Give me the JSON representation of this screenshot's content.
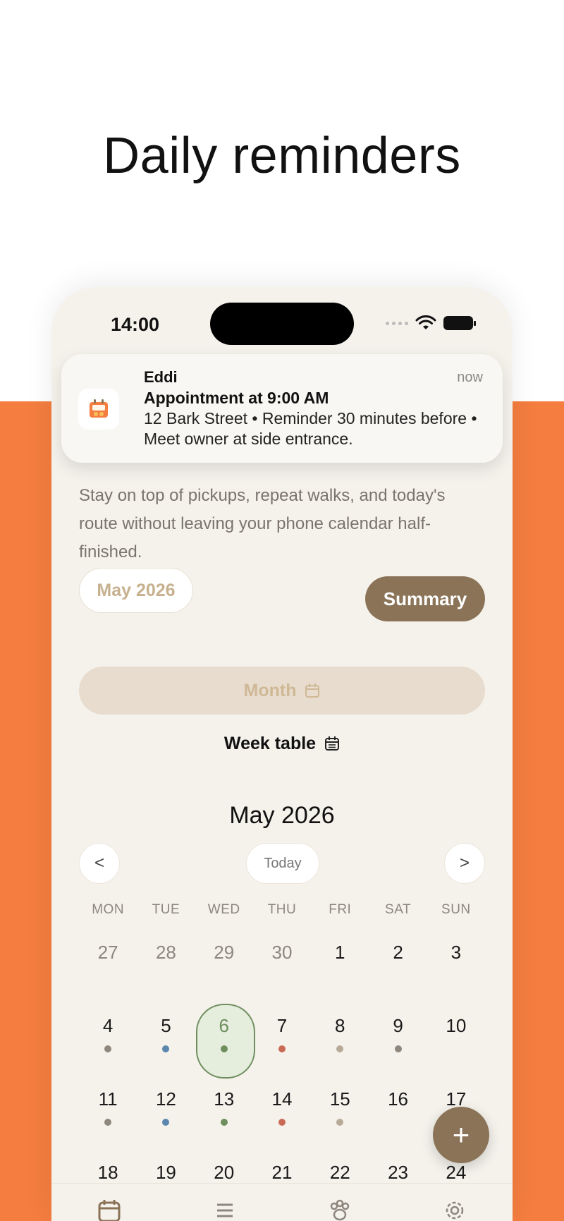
{
  "headline": "Daily reminders",
  "colors": {
    "accent": "#f47d3f",
    "brand": "#8a7357",
    "selected": "#6e8e5e"
  },
  "status_bar": {
    "time": "14:00"
  },
  "notification": {
    "app": "Eddi",
    "time": "now",
    "title": "Appointment at 9:00 AM",
    "body": "12 Bark Street • Reminder 30 minutes before • Meet owner at side entrance."
  },
  "intro": "Stay on top of pickups, repeat walks, and today's route without leaving your phone calendar half-finished.",
  "month_pill": "May 2026",
  "summary_label": "Summary",
  "view_toggle": {
    "month": "Month",
    "week": "Week table"
  },
  "calendar": {
    "title": "May 2026",
    "prev": "<",
    "next": ">",
    "today": "Today",
    "weekdays": [
      "MON",
      "TUE",
      "WED",
      "THU",
      "FRI",
      "SAT",
      "SUN"
    ],
    "days": [
      {
        "n": "27",
        "muted": true
      },
      {
        "n": "28",
        "muted": true
      },
      {
        "n": "29",
        "muted": true
      },
      {
        "n": "30",
        "muted": true
      },
      {
        "n": "1"
      },
      {
        "n": "2"
      },
      {
        "n": "3"
      },
      {
        "n": "4",
        "dot": "#8d877e"
      },
      {
        "n": "5",
        "dot": "#5b86ad"
      },
      {
        "n": "6",
        "dot": "#6e8e5e",
        "selected": true
      },
      {
        "n": "7",
        "dot": "#c96a55"
      },
      {
        "n": "8",
        "dot": "#b7ab98"
      },
      {
        "n": "9",
        "dot": "#8d877e"
      },
      {
        "n": "10"
      },
      {
        "n": "11",
        "dot": "#8d877e"
      },
      {
        "n": "12",
        "dot": "#5b86ad"
      },
      {
        "n": "13",
        "dot": "#6e8e5e"
      },
      {
        "n": "14",
        "dot": "#c96a55"
      },
      {
        "n": "15",
        "dot": "#b7ab98"
      },
      {
        "n": "16"
      },
      {
        "n": "17"
      },
      {
        "n": "18"
      },
      {
        "n": "19"
      },
      {
        "n": "20"
      },
      {
        "n": "21"
      },
      {
        "n": "22"
      },
      {
        "n": "23"
      },
      {
        "n": "24"
      }
    ]
  },
  "fab_label": "+",
  "tabs": [
    {
      "icon": "calendar-icon"
    },
    {
      "icon": "list-icon"
    },
    {
      "icon": "paw-icon"
    },
    {
      "icon": "gear-icon"
    }
  ]
}
